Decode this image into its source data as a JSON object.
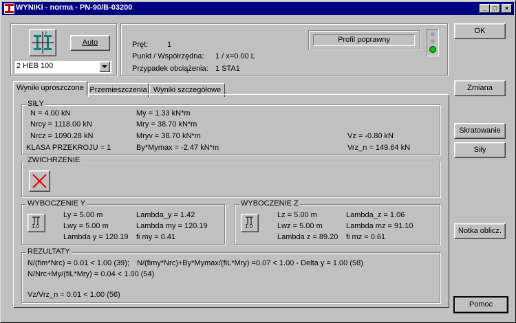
{
  "window": {
    "title": "WYNIKI - norma - PN-90/B-03200"
  },
  "top": {
    "auto_label": "Auto",
    "profile_select": "2 HEB 100",
    "pret_label": "Pręt:",
    "pret_value": "1",
    "punkt_label": "Punkt / Współrzędna:",
    "punkt_value": "1 / x=0.00 L",
    "przypadek_label": "Przypadek obciążenia:",
    "przypadek_value": "1 STA1",
    "status": "Profil poprawny",
    "status_color": "#00c000"
  },
  "buttons": {
    "ok": "OK",
    "zmiana": "Zmiana",
    "skratowanie": "Skratowanie",
    "sily": "Siły",
    "notka": "Notka oblicz.",
    "pomoc": "Pomoc"
  },
  "tabs": [
    "Wyniki uproszczone",
    "Przemieszczenia",
    "Wyniki szczegółowe"
  ],
  "sily": {
    "title": "SIŁY",
    "n": "N = 4.00 kN",
    "nrcy": "Nrcy = 1118.00 kN",
    "nrcz": "Nrcz = 1090.28 kN",
    "klasa": "KLASA PRZEKROJU = 1",
    "my": "My = 1.33 kN*m",
    "mry": "Mry = 38.70 kN*m",
    "mryv": "Mryv = 38.70 kN*m",
    "bymymax": "By*Mymax = -2.47 kN*m",
    "vz": "Vz = -0.80 kN",
    "vrzn": "Vrz_n = 149.64 kN"
  },
  "zwichrzenie": {
    "title": "ZWICHRZENIE"
  },
  "wyboczenie_y": {
    "title": "WYBOCZENIE Y",
    "ly": "Ly = 5.00 m",
    "lwy": "Lwy = 5.00 m",
    "lambday": "Lambda y = 120.19",
    "lambda_y": "Lambda_y = 1.42",
    "lambda_my": "Lambda my = 120.19",
    "fimy": "fi my = 0.41",
    "icon_text": "1.0"
  },
  "wyboczenie_z": {
    "title": "WYBOCZENIE Z",
    "lz": "Lz = 5.00 m",
    "lwz": "Lwz = 5.00 m",
    "lambdaz": "Lambda z = 89.20",
    "lambda_z": "Lambda_z = 1.06",
    "lambda_mz": "Lambda mz = 91.10",
    "fimz": "fi mz = 0.61",
    "icon_text": "1.0"
  },
  "rezultaty": {
    "title": "REZULTATY",
    "l1a": "N/(fim*Nrc) = 0.01 < 1.00 (39);",
    "l1b": "N/(fimy*Nrc)+By*Mymax/(fiL*Mry) =0.07 < 1.00 - Delta y = 1.00 (58)",
    "l2": "N/Nrc+My/(fiL*Mry) = 0.04 < 1.00  (54)",
    "l3": "Vz/Vrz_n = 0.01 < 1.00   (56)"
  }
}
